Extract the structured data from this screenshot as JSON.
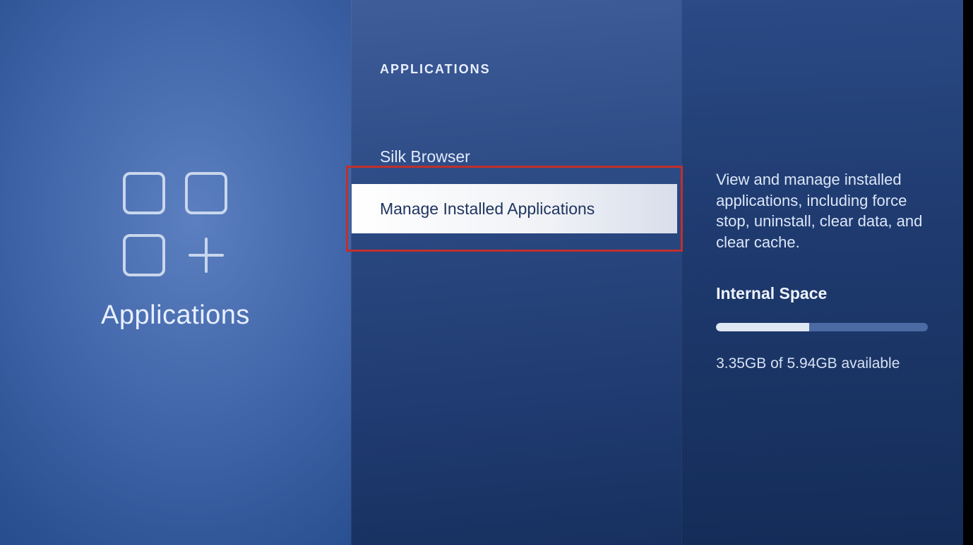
{
  "left": {
    "title": "Applications"
  },
  "mid": {
    "header": "APPLICATIONS",
    "items": [
      {
        "label": "Silk Browser",
        "selected": false
      },
      {
        "label": "Manage Installed Applications",
        "selected": true
      }
    ]
  },
  "right": {
    "description": "View and manage installed applications, including force stop, uninstall, clear data, and clear cache.",
    "space_title": "Internal Space",
    "space_used_gb": 3.35,
    "space_total_gb": 5.94,
    "space_text": "3.35GB of 5.94GB available",
    "progress_percent": 44
  },
  "annotation": {
    "highlight_target": "menu-item-manage-installed-applications"
  }
}
